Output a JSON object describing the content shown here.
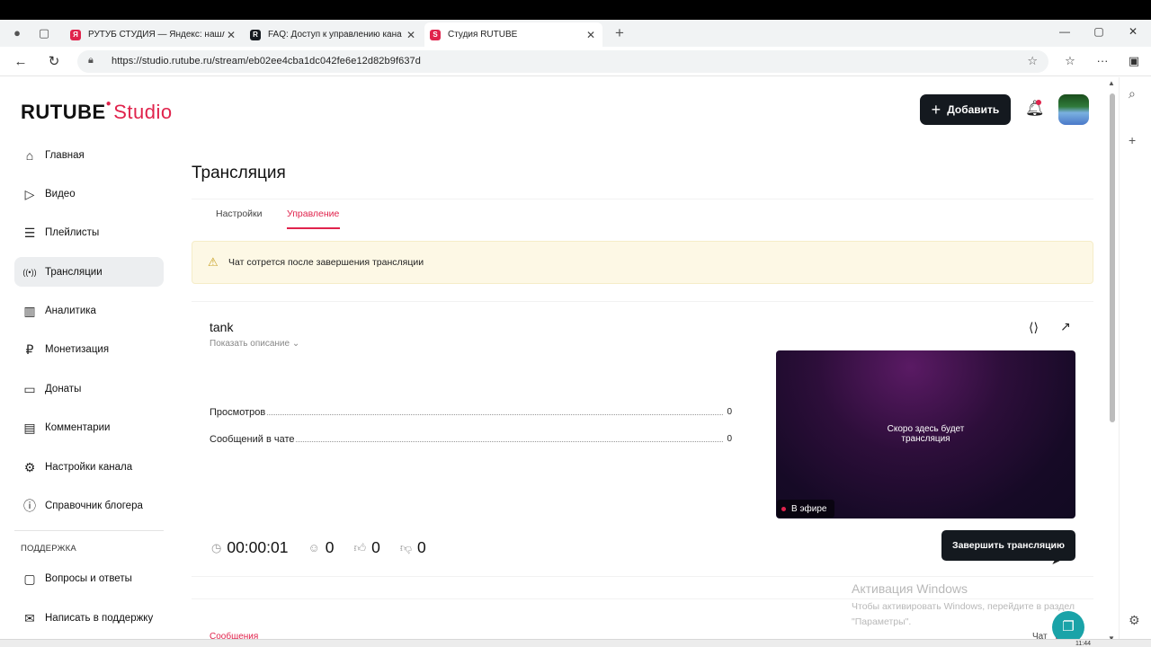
{
  "browser": {
    "tabs": [
      {
        "title": "РУТУБ СТУДИЯ — Яндекс: нашл",
        "favicon": "Я",
        "color": "#e0234c"
      },
      {
        "title": "FAQ: Доступ к управлению кана",
        "favicon": "R",
        "color": "#14191f"
      },
      {
        "title": "Студия RUTUBE",
        "favicon": "S",
        "color": "#e0234c"
      }
    ],
    "url": "https://studio.rutube.ru/stream/eb02ee4cba1dc042fe6e12d82b9f637d"
  },
  "header": {
    "logo_main": "RUTUBE",
    "logo_sub": "Studio",
    "add_label": "Добавить"
  },
  "sidebar": {
    "items": [
      {
        "label": "Главная",
        "icon": "home-icon",
        "glyph": "⌂"
      },
      {
        "label": "Видео",
        "icon": "video-icon",
        "glyph": "▷"
      },
      {
        "label": "Плейлисты",
        "icon": "playlist-icon",
        "glyph": "☰"
      },
      {
        "label": "Трансляции",
        "icon": "broadcast-icon",
        "glyph": "((•))"
      },
      {
        "label": "Аналитика",
        "icon": "analytics-icon",
        "glyph": "▥"
      },
      {
        "label": "Монетизация",
        "icon": "monetization-icon",
        "glyph": "₽"
      },
      {
        "label": "Донаты",
        "icon": "donate-icon",
        "glyph": "▭"
      },
      {
        "label": "Комментарии",
        "icon": "comments-icon",
        "glyph": "▤"
      },
      {
        "label": "Настройки канала",
        "icon": "gear-icon",
        "glyph": "⚙"
      },
      {
        "label": "Справочник блогера",
        "icon": "info-icon",
        "glyph": "ⓘ"
      }
    ],
    "active_index": 3,
    "section_title": "ПОДДЕРЖКА",
    "support_items": [
      {
        "label": "Вопросы и ответы",
        "icon": "faq-icon",
        "glyph": "▢"
      },
      {
        "label": "Написать в поддержку",
        "icon": "mail-icon",
        "glyph": "✉"
      }
    ]
  },
  "main": {
    "title": "Трансляция",
    "tabs": [
      "Настройки",
      "Управление"
    ],
    "active_tab": "Управление",
    "warning": "Чат сотрется после завершения трансляции",
    "stream": {
      "name": "tank",
      "show_description": "Показать описание",
      "stats": [
        {
          "label": "Просмотров",
          "value": "0"
        },
        {
          "label": "Сообщений в чате",
          "value": "0"
        }
      ],
      "player_text_1": "Скоро здесь будет",
      "player_text_2": "трансляция",
      "live_label": "В эфире",
      "timer": "00:00:01",
      "viewers": "0",
      "likes": "0",
      "dislikes": "0",
      "end_label": "Завершить трансляцию"
    },
    "chat": {
      "messages_tab": "Сообщения",
      "chat_label": "Чат"
    }
  },
  "overlay": {
    "activation_title": "Активация Windows",
    "activation_text": "Чтобы активировать Windows, перейдите в раздел \"Параметры\"."
  },
  "taskbar": {
    "clock": "11:44"
  }
}
